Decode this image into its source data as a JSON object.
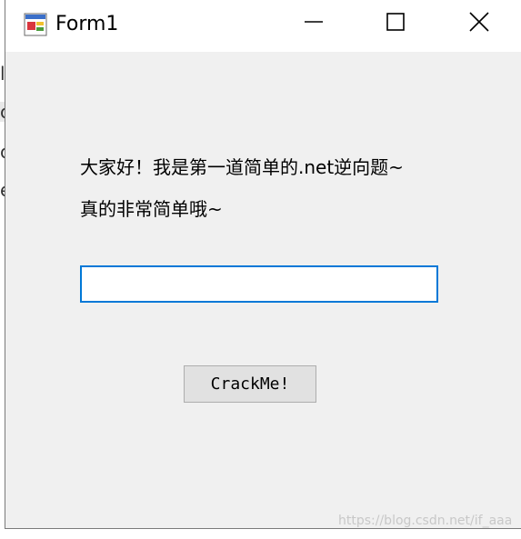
{
  "window": {
    "title": "Form1"
  },
  "titlebar": {
    "app_icon": "winforms-app-icon",
    "minimize_icon": "minimize-icon",
    "maximize_icon": "maximize-icon",
    "close_icon": "close-icon"
  },
  "form": {
    "label_line1": "大家好！我是第一道简单的.net逆向题~",
    "label_line2": "真的非常简单哦~",
    "input_value": "",
    "button_label": "CrackMe!"
  },
  "background_fragments": [
    "lc",
    "c",
    "c",
    "e"
  ],
  "watermark": "https://blog.csdn.net/if_aaa",
  "colors": {
    "window_bg": "#f0f0f0",
    "titlebar_bg": "#ffffff",
    "input_focus_border": "#0078d7",
    "button_bg": "#e1e1e1"
  }
}
